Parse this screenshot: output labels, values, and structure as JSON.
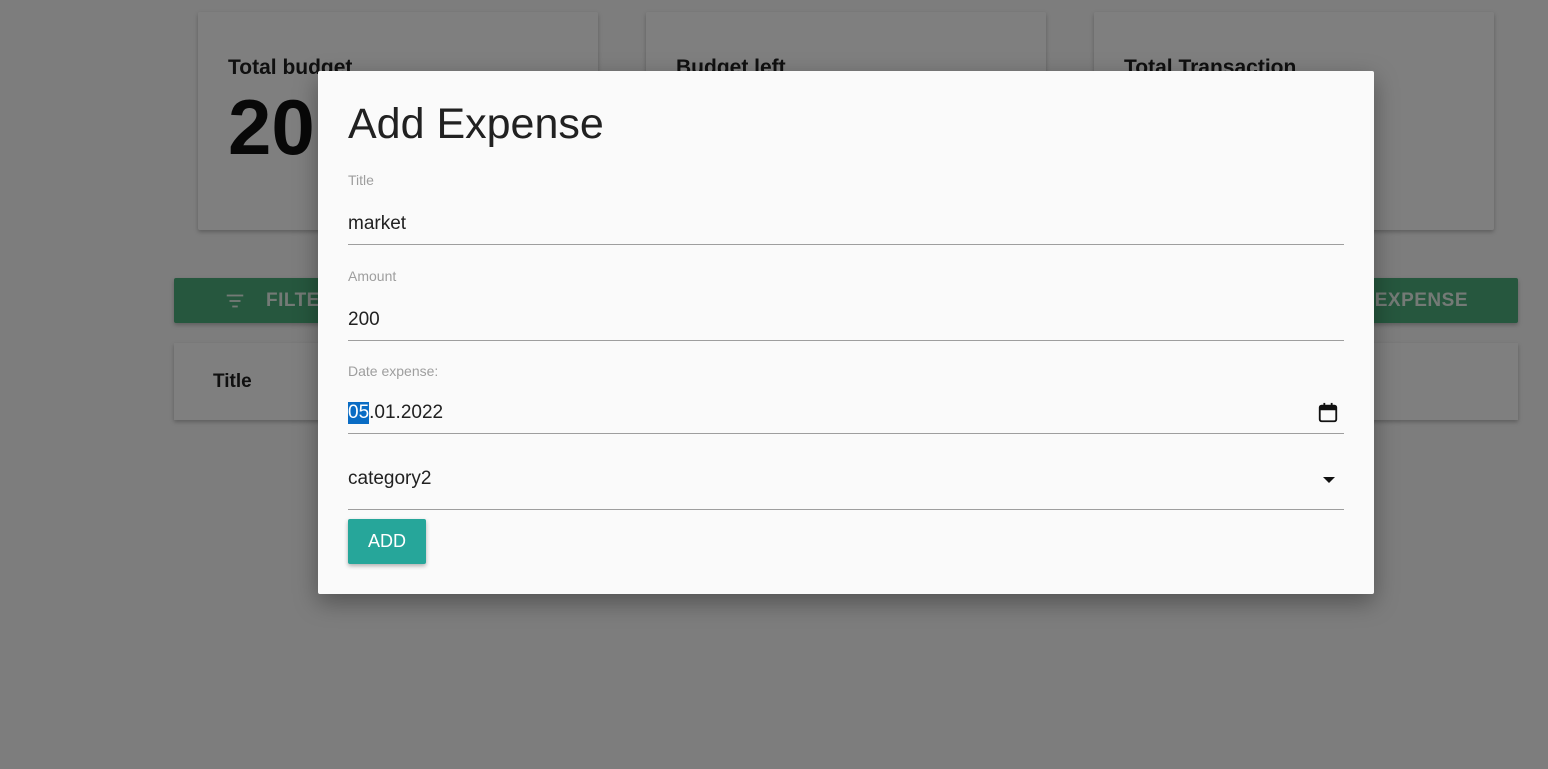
{
  "dashboard": {
    "cards": [
      {
        "label": "Total budget",
        "value": "20"
      },
      {
        "label": "Budget left",
        "value": ""
      },
      {
        "label": "Total Transaction",
        "value": ""
      }
    ],
    "filter_label": "FILTE",
    "add_expense_label": "D EXPENSE",
    "table": {
      "title_header": "Title"
    }
  },
  "modal": {
    "heading": "Add Expense",
    "title_field": {
      "label": "Title",
      "value": "market"
    },
    "amount_field": {
      "label": "Amount",
      "value": "200"
    },
    "date_field": {
      "label": "Date expense:",
      "day": "05",
      "rest": ".01.2022"
    },
    "category_select": {
      "selected": "category2"
    },
    "add_button_label": "ADD"
  },
  "colors": {
    "accent_green": "#4caf7d",
    "button_teal": "#26a69a",
    "selection_blue": "#0a6cc4"
  },
  "icons": [
    "filter-icon",
    "calendar-icon",
    "caret-down-icon"
  ]
}
